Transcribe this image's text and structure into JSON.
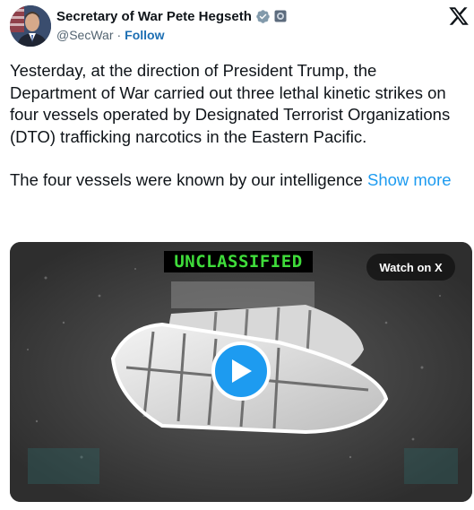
{
  "author": {
    "display_name": "Secretary of War Pete Hegseth",
    "handle": "@SecWar",
    "separator": "·",
    "follow_label": "Follow"
  },
  "icons": {
    "verified": "verified-badge-icon",
    "affiliation": "affiliation-badge-icon",
    "platform_logo": "x-logo-icon",
    "play": "play-icon"
  },
  "post": {
    "paragraph_1": "Yesterday, at the direction of President Trump, the Department of War carried out three lethal kinetic strikes on four vessels operated by Designated Terrorist Organizations (DTO) trafficking narcotics in the Eastern Pacific.",
    "paragraph_2": "The four vessels were known by our intelligence",
    "show_more_label": "Show more"
  },
  "media": {
    "overlay_label": "UNCLASSIFIED",
    "watch_label": "Watch on X"
  },
  "colors": {
    "link_blue": "#1d9bf0",
    "follow_blue": "#1d6fb3",
    "text": "#0f1419",
    "secondary": "#536471",
    "overlay_green": "#3fdc3a",
    "verified_gray": "#829aab"
  }
}
